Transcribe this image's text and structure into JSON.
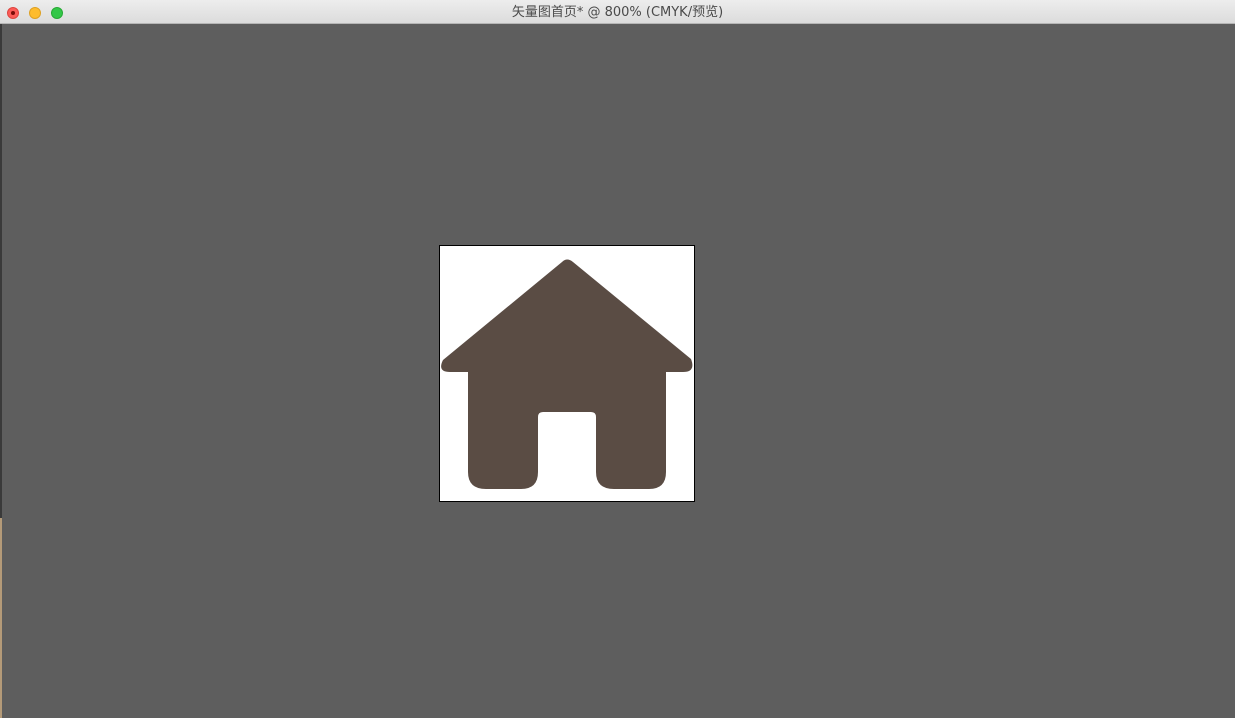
{
  "window": {
    "title": "矢量图首页* @ 800% (CMYK/预览)"
  },
  "colors": {
    "canvas_background": "#5e5e5e",
    "artboard_background": "#ffffff",
    "house_fill": "#5a4c44"
  },
  "artwork": {
    "icon": "home-icon"
  }
}
